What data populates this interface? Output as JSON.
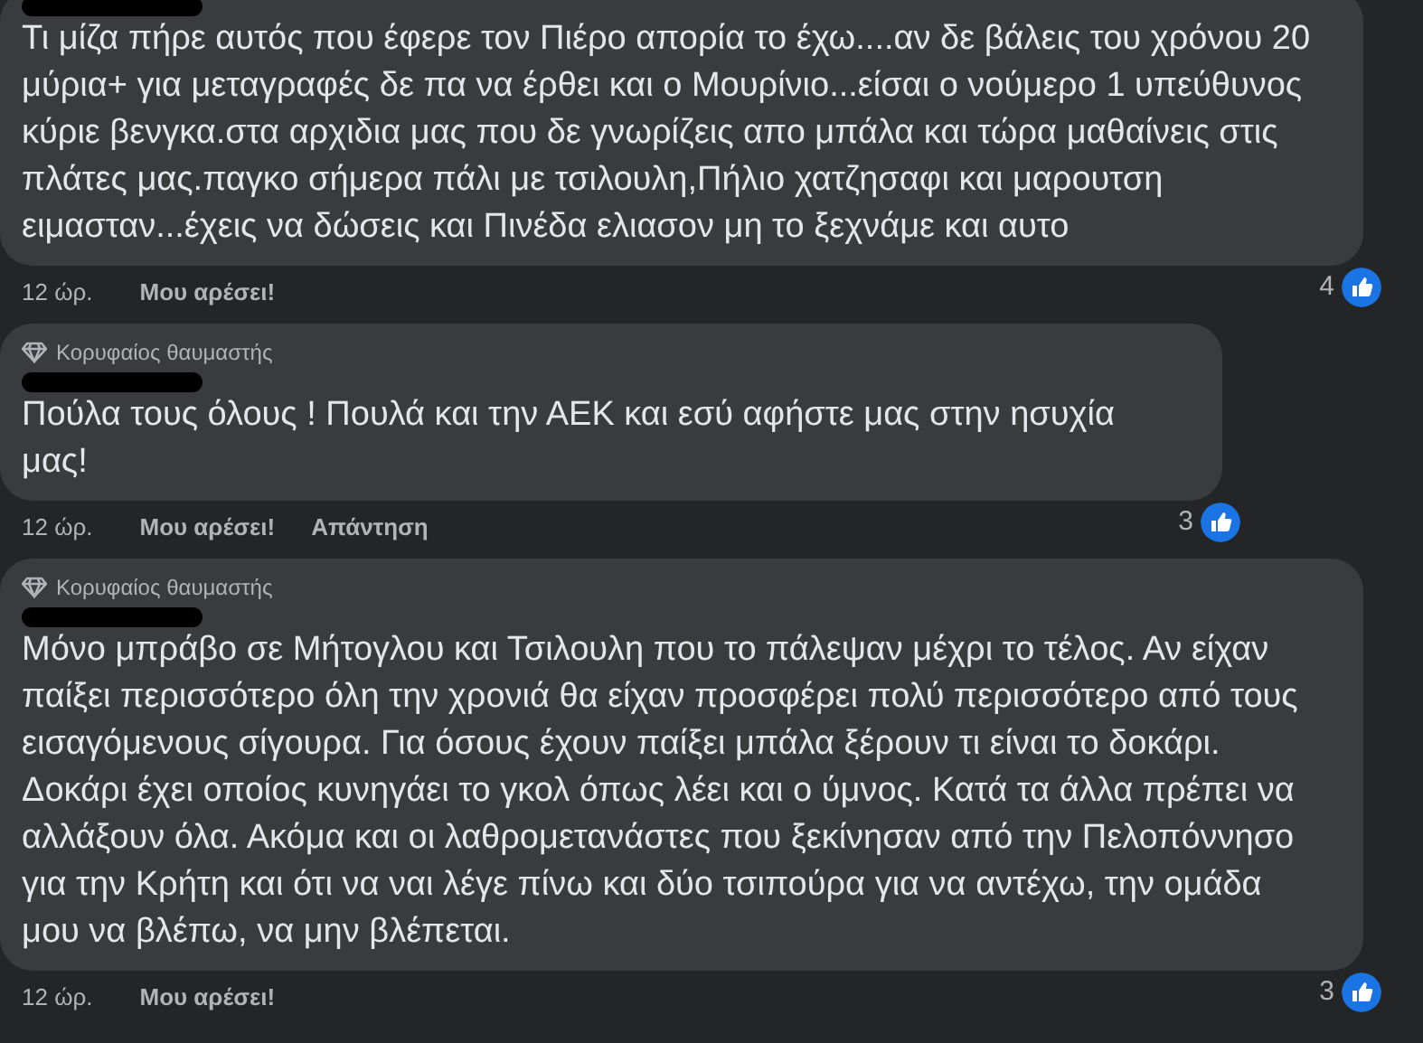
{
  "comments": [
    {
      "text": "Τι μίζα πήρε αυτός που έφερε τον Πιέρο απορία το έχω....αν δε βάλεις του χρόνου 20 μύρια+ για μεταγραφές δε πα να έρθει και ο Μουρίνιο...είσαι ο νούμερο 1 υπεύθυνος κύριε βενγκα.στα αρχιδια μας που δε γνωρίζεις απο μπάλα και τώρα μαθαίνεις στις πλάτες μας.παγκο σήμερα πάλι με τσιλουλη,Πήλιο χατζησαφι και μαρουτση ειμασταν...έχεις να δώσεις και Πινέδα ελιασον μη το ξεχνάμε και αυτο",
      "time": "12 ώρ.",
      "like": "Μου αρέσει!",
      "reactions": "4"
    },
    {
      "badge": "Κορυφαίος θαυμαστής",
      "text": "Πούλα τους όλους ! Πουλά και την ΑΕΚ και εσύ αφήστε μας στην ησυχία μας!",
      "time": "12 ώρ.",
      "like": "Μου αρέσει!",
      "reply": "Απάντηση",
      "reactions": "3"
    },
    {
      "badge": "Κορυφαίος θαυμαστής",
      "text": "Μόνο μπράβο σε Μήτογλου και Τσιλουλη που το πάλεψαν μέχρι το τέλος. Αν είχαν παίξει περισσότερο όλη την χρονιά θα είχαν προσφέρει πολύ περισσότερο από τους εισαγόμενους σίγουρα. Για όσους έχουν παίξει μπάλα ξέρουν τι είναι το δοκάρι. Δοκάρι έχει οποίος κυνηγάει το γκολ όπως λέει και ο ύμνος. Κατά τα άλλα πρέπει να αλλάξουν όλα. Ακόμα και οι λαθρομετανάστες που ξεκίνησαν από την Πελοπόννησο για την Κρήτη και ότι να ναι λέγε πίνω και δύο τσιπούρα για να αντέχω, την ομάδα μου να βλέπω, να μην βλέπεται.",
      "time": "12 ώρ.",
      "like": "Μου αρέσει!",
      "reactions": "3"
    }
  ]
}
